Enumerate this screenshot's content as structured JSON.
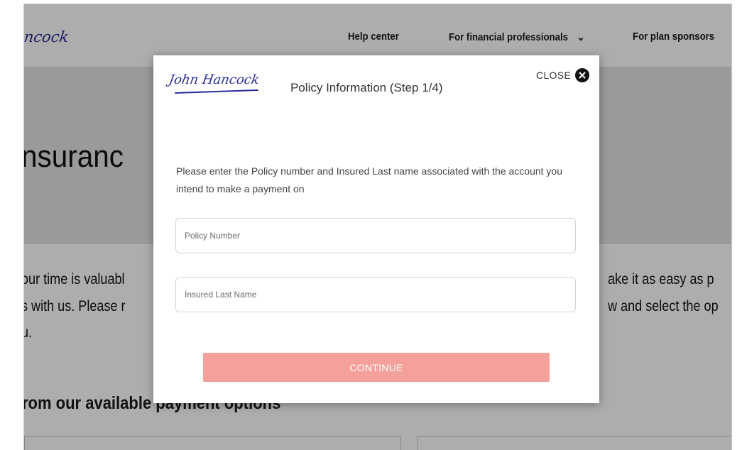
{
  "background": {
    "logo_fragment": "ncock",
    "nav": {
      "help_center": "Help center",
      "financial_professionals": "For financial professionals",
      "plan_sponsors": "For plan sponsors"
    },
    "hero_title": "nsuranc",
    "body_lines_left": [
      "our time is valuabl",
      "s with us. Please r",
      "u."
    ],
    "body_lines_right": [
      "ake it as easy as p",
      "w and select the op"
    ],
    "section_title": "rom our available payment options"
  },
  "modal": {
    "logo_text": "John Hancock",
    "title": "Policy Information (Step 1/4)",
    "close_label": "CLOSE",
    "instructions": "Please enter the Policy number and Insured Last name associated with the account you intend to make a payment on",
    "policy_number_placeholder": "Policy Number",
    "last_name_placeholder": "Insured Last Name",
    "continue_label": "CONTINUE"
  },
  "colors": {
    "brand_blue": "#2b2b9a",
    "continue_button": "#f3a19a",
    "overlay": "rgba(0,0,0,0.32)"
  }
}
